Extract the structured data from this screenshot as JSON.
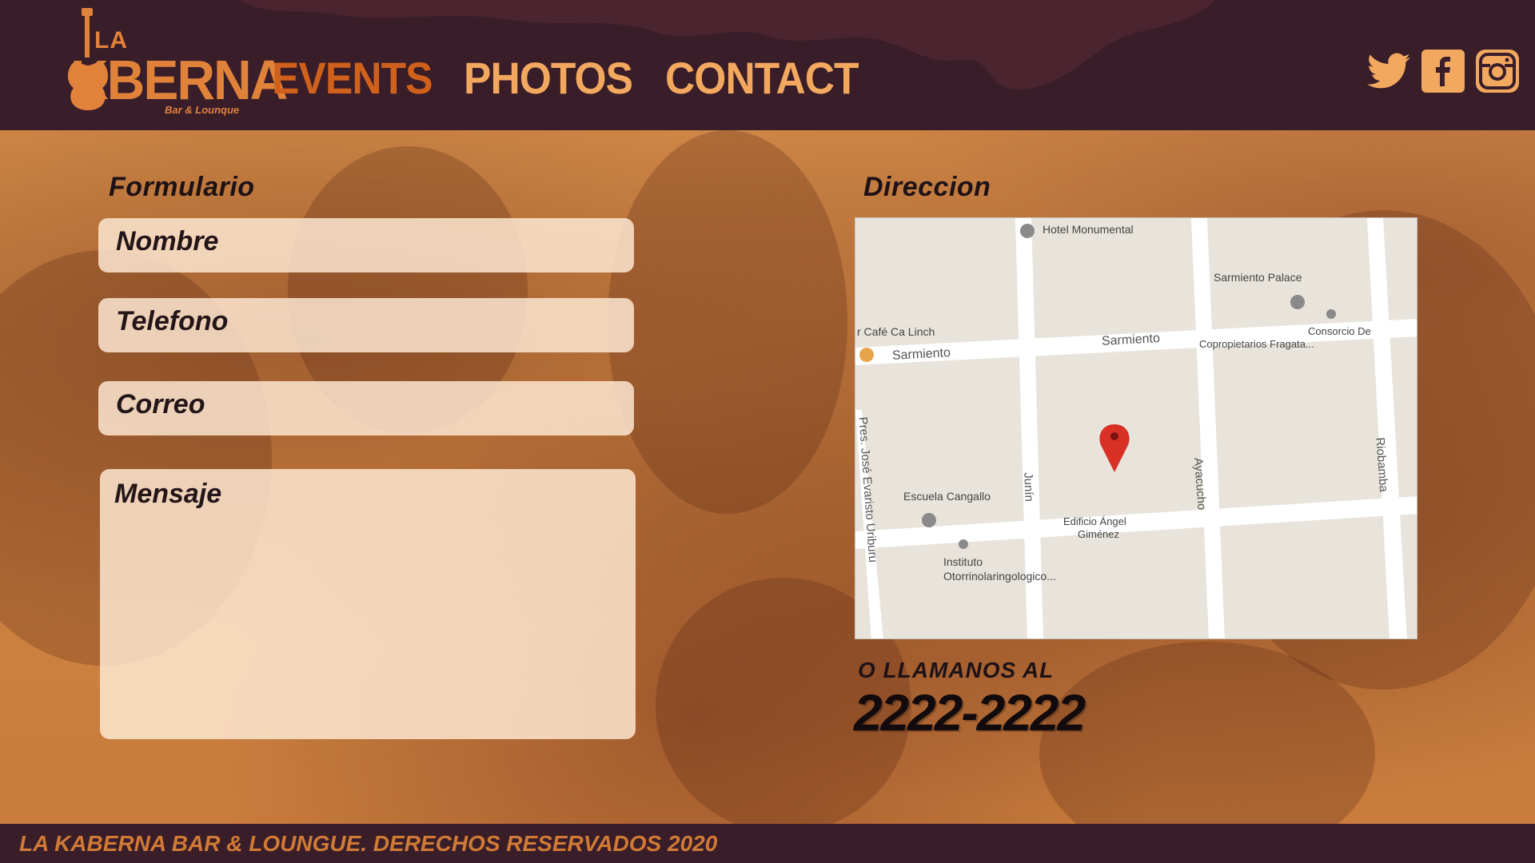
{
  "brand": {
    "la": "LA",
    "name": "KBERNA",
    "tagline": "Bar & Lounque"
  },
  "nav": {
    "events": "EVENTS",
    "photos": "PHOTOS",
    "contact": "CONTACT"
  },
  "social": [
    "twitter-icon",
    "facebook-icon",
    "instagram-icon"
  ],
  "form": {
    "title": "Formulario",
    "nombre_placeholder": "Nombre",
    "telefono_placeholder": "Telefono",
    "correo_placeholder": "Correo",
    "mensaje_placeholder": "Mensaje"
  },
  "address": {
    "title": "Direccion",
    "map_labels": {
      "hotel": "Hotel Monumental",
      "palace": "Sarmiento Palace",
      "cafe": "r Café Ca Linch",
      "consorcio_1": "Consorcio De",
      "consorcio_2": "Copropietarios Fragata...",
      "sarmiento_left": "Sarmiento",
      "sarmiento_right": "Sarmiento",
      "uriburu": "Pres. José Evaristo Uriburu",
      "junin": "Junín",
      "ayacucho": "Ayacucho",
      "riobamba": "Riobamba",
      "escuela": "Escuela Cangallo",
      "edificio_1": "Edificio Ángel",
      "edificio_2": "Giménez",
      "instituto_1": "Instituto",
      "instituto_2": "Otorrinolaringologico..."
    }
  },
  "call": {
    "label": "O LLAMANOS AL",
    "phone": "2222-2222"
  },
  "footer": {
    "text": "LA KABERNA BAR & LOUNGUE. DERECHOS RESERVADOS 2020"
  },
  "colors": {
    "header_bg": "#391d29",
    "accent_orange": "#e0823a",
    "nav_active": "#d0611c",
    "nav_text": "#f2a85e"
  }
}
